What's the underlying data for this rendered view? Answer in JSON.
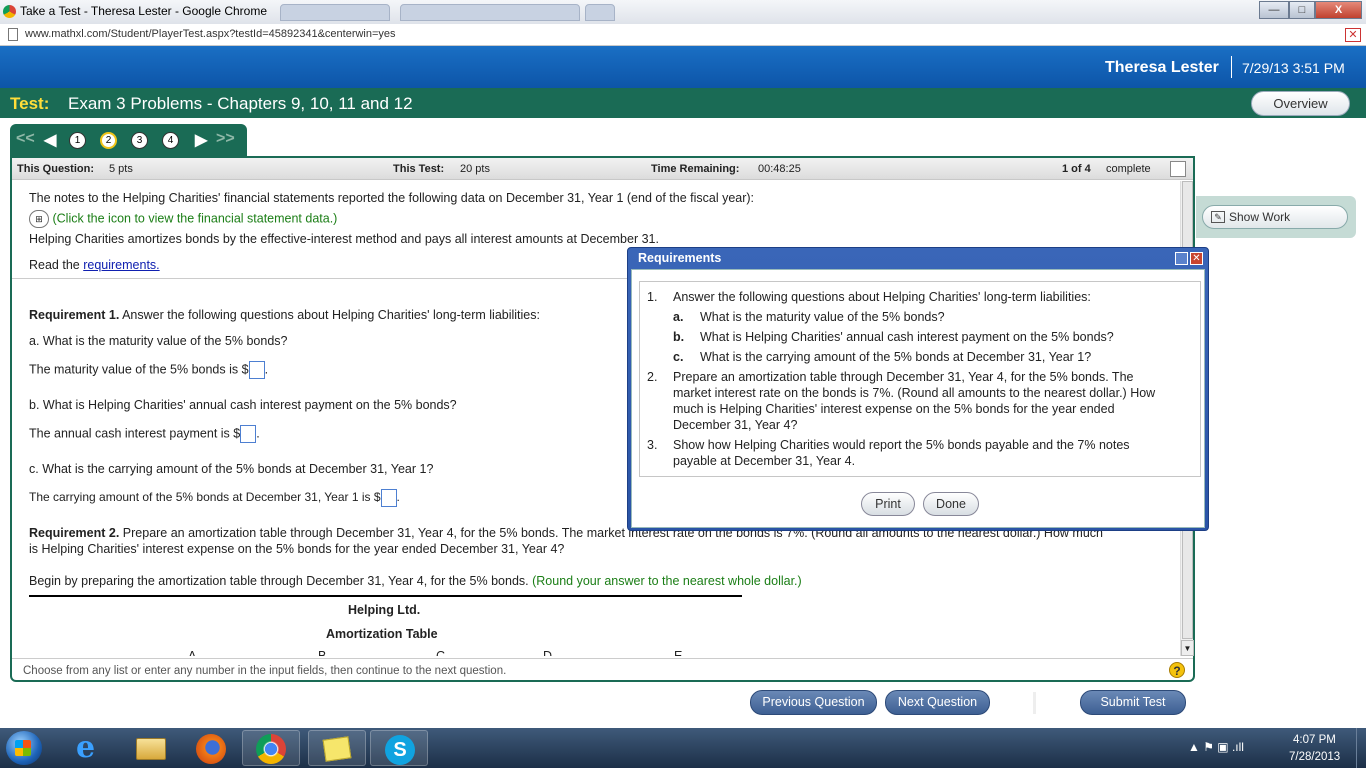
{
  "browser": {
    "window_title": "Take a Test - Theresa Lester - Google Chrome",
    "url": "www.mathxl.com/Student/PlayerTest.aspx?testId=45892341&centerwin=yes",
    "min_label": "—",
    "max_label": "□",
    "close_label": "X"
  },
  "header": {
    "user_name": "Theresa Lester",
    "datetime": "7/29/13 3:51 PM",
    "test_label": "Test:",
    "test_name": "Exam 3 Problems - Chapters 9, 10, 11 and 12",
    "overview_label": "Overview"
  },
  "nav": {
    "first": "<<",
    "prev": "<",
    "next": ">",
    "last": ">>",
    "questions": [
      "1",
      "2",
      "3",
      "4"
    ],
    "current": "2"
  },
  "info": {
    "this_question_label": "This Question:",
    "this_question_value": "5 pts",
    "this_test_label": "This Test:",
    "this_test_value": "20 pts",
    "time_remaining_label": "Time Remaining:",
    "time_remaining_value": "00:48:25",
    "progress_count": "1 of 4",
    "progress_label": "complete"
  },
  "question": {
    "intro": "The notes to the Helping Charities' financial statements reported the following data on December 31, Year 1 (end of the fiscal year):",
    "icon_link": "(Click the icon to view the financial statement data.)",
    "method": "Helping Charities amortizes bonds by the effective-interest method and pays all interest amounts at December 31.",
    "read_prefix": "Read the ",
    "read_link": "requirements.",
    "req1_label": "Requirement 1.",
    "req1_text": " Answer the following questions about Helping Charities' long-term liabilities:",
    "qa": "a. What is the maturity value of the 5% bonds?",
    "qa_answer_prefix": "The maturity value of the 5% bonds is $",
    "qb": "b. What is Helping Charities' annual cash interest payment on the 5% bonds?",
    "qb_answer_prefix": "The annual cash interest payment is $",
    "qc": "c. What is the carrying amount of the 5% bonds at December 31, Year 1?",
    "qc_answer_prefix": "The carrying amount of the 5% bonds at December 31, Year 1 is $",
    "req2_label": "Requirement 2.",
    "req2_text_line1": " Prepare an amortization table through December 31, Year 4, for the 5% bonds. The market interest rate on the bonds is 7%. (Round all amounts to the nearest dollar.) How much",
    "req2_text_line2": "is Helping Charities' interest expense on the 5% bonds for the year ended December 31, Year 4?",
    "begin_text": "Begin by preparing the amortization table through December 31, Year 4, for the 5% bonds.",
    "begin_note": " (Round your answer to the nearest whole dollar.)",
    "table_company": "Helping Ltd.",
    "table_title": "Amortization Table",
    "table_cols": [
      "A",
      "B",
      "C",
      "D",
      "E"
    ]
  },
  "footer": {
    "hint": "Choose from any list or enter any number in the input fields, then continue to the next question."
  },
  "show_work": {
    "label": "Show Work"
  },
  "popup": {
    "title": "Requirements",
    "items": [
      {
        "num": "1.",
        "text": "Answer the following questions about Helping Charities' long-term liabilities:"
      },
      {
        "num": "a.",
        "text": "What is the maturity value of the 5% bonds?"
      },
      {
        "num": "b.",
        "text": "What is Helping Charities' annual cash interest payment on the 5% bonds?"
      },
      {
        "num": "c.",
        "text": "What is the carrying amount of the 5% bonds at December 31, Year 1?"
      },
      {
        "num": "2.",
        "line1": "Prepare an amortization table through December 31, Year 4, for the 5% bonds. The",
        "line2": "market interest rate on the bonds is 7%. (Round all amounts to the nearest dollar.) How",
        "line3": "much is Helping Charities' interest expense on the 5% bonds for the year ended",
        "line4": "December 31, Year 4?"
      },
      {
        "num": "3.",
        "line1": "Show how Helping Charities would report the 5% bonds payable and the 7% notes",
        "line2": "payable at December 31, Year 4."
      }
    ],
    "print_label": "Print",
    "done_label": "Done"
  },
  "bottom": {
    "previous_label": "Previous Question",
    "next_label": "Next Question",
    "submit_label": "Submit Test"
  },
  "taskbar": {
    "time": "4:07 PM",
    "date": "7/28/2013",
    "tray": "▲  ⚑ ▣ .ıll"
  }
}
